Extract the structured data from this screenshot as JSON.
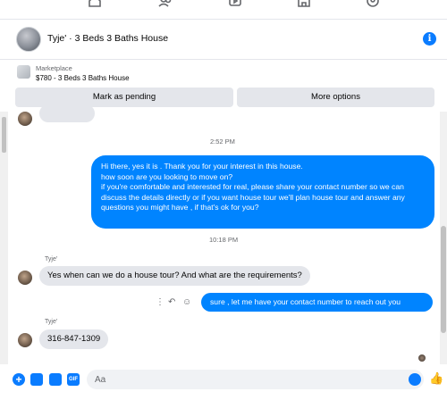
{
  "colors": {
    "accent": "#0084ff",
    "incoming_bubble": "#e4e6eb",
    "muted_text": "#65676b"
  },
  "topnav": {
    "icons": [
      "home-icon",
      "friends-icon",
      "watch-icon",
      "marketplace-icon",
      "groups-icon"
    ]
  },
  "header": {
    "title": "Tyje' · 3 Beds 3 Baths House"
  },
  "marketplace": {
    "label": "Marketplace",
    "listing": "$780 - 3 Beds 3 Baths House",
    "mark_pending_label": "Mark as pending",
    "more_options_label": "More options"
  },
  "messages": {
    "timestamp_1": "2:52 PM",
    "outgoing_long": "Hi there, yes it is . Thank you for your interest in this house.\nhow soon are you looking to move on?\nif you're comfortable and interested for real, please share your contact number so we can discuss the details directly or if you  want house tour we'll plan house tour and answer any questions you might have , if that's ok for you?",
    "timestamp_2": "10:18 PM",
    "sender_name": "Tyje'",
    "incoming_1": "Yes when can we do a house tour? And what are the requirements?",
    "outgoing_short": "sure , let me have your contact number to reach out you",
    "sender_name_2": "Tyje'",
    "incoming_2": "316-847-1309"
  },
  "composer": {
    "placeholder": "Aa"
  }
}
